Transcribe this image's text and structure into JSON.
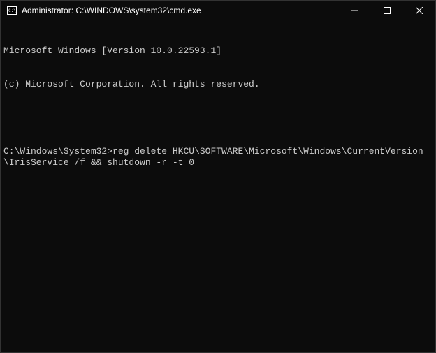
{
  "window": {
    "title": "Administrator: C:\\WINDOWS\\system32\\cmd.exe"
  },
  "terminal": {
    "header_line1": "Microsoft Windows [Version 10.0.22593.1]",
    "header_line2": "(c) Microsoft Corporation. All rights reserved.",
    "prompt": "C:\\Windows\\System32>",
    "command": "reg delete HKCU\\SOFTWARE\\Microsoft\\Windows\\CurrentVersion\\IrisService /f && shutdown -r -t 0"
  }
}
